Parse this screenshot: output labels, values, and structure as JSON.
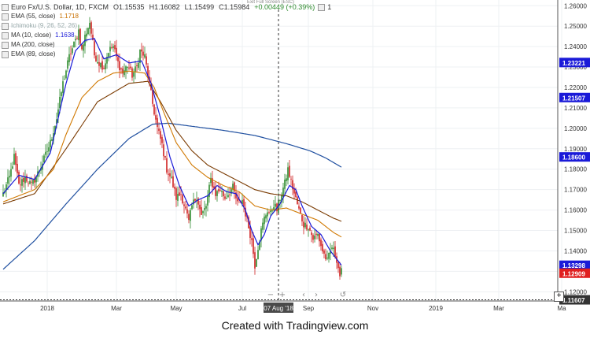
{
  "header": {
    "symbol": "Euro Fx/U.S. Dollar, 1D, FXCM",
    "open": "O1.15535",
    "high": "H1.16082",
    "low": "L1.15499",
    "close": "C1.15984",
    "change": "+0.00449 (+0.39%)",
    "badge": "1",
    "exit_full_screen": "Exit Full Screen (ESC)"
  },
  "indicators": [
    {
      "label": "EMA (55, close)",
      "value": "1.1718",
      "color": "#c87000"
    },
    {
      "label": "Ichimoku (9, 26, 52, 26)",
      "value": "",
      "color": "#999999"
    },
    {
      "label": "MA (10, close)",
      "value": "1.1638",
      "color": "#1a1ad8"
    },
    {
      "label": "MA (200, close)",
      "value": "",
      "color": "#2050a0"
    },
    {
      "label": "EMA (89, close)",
      "value": "",
      "color": "#7a3a00"
    }
  ],
  "footer": {
    "text": "Created with Tradingview.com"
  },
  "crosshair_date": "07 Aug '18",
  "chart_data": {
    "type": "candlestick",
    "x_ticks": [
      "2018",
      "Mar",
      "May",
      "Jul",
      "Sep",
      "Nov",
      "2019",
      "Mar",
      "Ma"
    ],
    "y_ticks": [
      "1.26000",
      "1.25000",
      "1.24000",
      "1.23000",
      "1.22000",
      "1.21000",
      "1.20000",
      "1.19000",
      "1.18000",
      "1.17000",
      "1.16000",
      "1.15000",
      "1.14000",
      "1.13000",
      "1.12000"
    ],
    "ylim": [
      1.1155,
      1.2628
    ],
    "price_labels": [
      {
        "text": "1.23221",
        "value": 1.23221,
        "color": "#1a1ad8"
      },
      {
        "text": "1.21507",
        "value": 1.21507,
        "color": "#1a1ad8"
      },
      {
        "text": "1.18600",
        "value": 1.186,
        "color": "#1a1ad8"
      },
      {
        "text": "1.13298",
        "value": 1.13298,
        "color": "#1a1ad8"
      },
      {
        "text": "1.12909",
        "value": 1.12909,
        "color": "#e02020"
      },
      {
        "text": "1.11607",
        "value": 1.11607,
        "color": "#333333"
      }
    ],
    "horizontal_line": 1.11607,
    "up_color": "#2e8b2e",
    "down_color": "#d02020",
    "keypoints": [
      [
        0,
        1.168
      ],
      [
        4,
        1.176
      ],
      [
        7,
        1.186
      ],
      [
        10,
        1.172
      ],
      [
        14,
        1.176
      ],
      [
        18,
        1.172
      ],
      [
        22,
        1.178
      ],
      [
        26,
        1.185
      ],
      [
        30,
        1.193
      ],
      [
        34,
        1.205
      ],
      [
        38,
        1.222
      ],
      [
        42,
        1.235
      ],
      [
        46,
        1.243
      ],
      [
        48,
        1.248
      ],
      [
        50,
        1.238
      ],
      [
        52,
        1.245
      ],
      [
        55,
        1.252
      ],
      [
        58,
        1.236
      ],
      [
        61,
        1.232
      ],
      [
        64,
        1.23
      ],
      [
        67,
        1.238
      ],
      [
        70,
        1.24
      ],
      [
        73,
        1.232
      ],
      [
        76,
        1.227
      ],
      [
        79,
        1.231
      ],
      [
        82,
        1.226
      ],
      [
        85,
        1.23
      ],
      [
        87,
        1.238
      ],
      [
        90,
        1.235
      ],
      [
        92,
        1.226
      ],
      [
        95,
        1.212
      ],
      [
        98,
        1.2
      ],
      [
        101,
        1.192
      ],
      [
        104,
        1.18
      ],
      [
        107,
        1.175
      ],
      [
        110,
        1.166
      ],
      [
        113,
        1.168
      ],
      [
        116,
        1.16
      ],
      [
        118,
        1.154
      ],
      [
        120,
        1.162
      ],
      [
        123,
        1.167
      ],
      [
        126,
        1.157
      ],
      [
        129,
        1.162
      ],
      [
        132,
        1.175
      ],
      [
        135,
        1.168
      ],
      [
        138,
        1.17
      ],
      [
        141,
        1.166
      ],
      [
        143,
        1.168
      ],
      [
        146,
        1.171
      ],
      [
        149,
        1.163
      ],
      [
        152,
        1.165
      ],
      [
        155,
        1.155
      ],
      [
        158,
        1.145
      ],
      [
        160,
        1.133
      ],
      [
        162,
        1.142
      ],
      [
        164,
        1.15
      ],
      [
        166,
        1.156
      ],
      [
        168,
        1.16
      ],
      [
        170,
        1.158
      ],
      [
        172,
        1.163
      ],
      [
        174,
        1.16
      ],
      [
        176,
        1.166
      ],
      [
        179,
        1.173
      ],
      [
        181,
        1.18
      ],
      [
        183,
        1.174
      ],
      [
        185,
        1.168
      ],
      [
        188,
        1.16
      ],
      [
        191,
        1.153
      ],
      [
        194,
        1.152
      ],
      [
        197,
        1.146
      ],
      [
        200,
        1.148
      ],
      [
        203,
        1.14
      ],
      [
        206,
        1.135
      ],
      [
        209,
        1.142
      ],
      [
        212,
        1.136
      ],
      [
        214,
        1.128
      ],
      [
        215,
        1.1298
      ]
    ],
    "ma10": [
      [
        0,
        1.168
      ],
      [
        10,
        1.177
      ],
      [
        20,
        1.175
      ],
      [
        30,
        1.188
      ],
      [
        40,
        1.222
      ],
      [
        46,
        1.238
      ],
      [
        52,
        1.243
      ],
      [
        58,
        1.244
      ],
      [
        64,
        1.234
      ],
      [
        72,
        1.236
      ],
      [
        80,
        1.232
      ],
      [
        88,
        1.233
      ],
      [
        94,
        1.222
      ],
      [
        100,
        1.205
      ],
      [
        106,
        1.186
      ],
      [
        112,
        1.172
      ],
      [
        118,
        1.162
      ],
      [
        124,
        1.165
      ],
      [
        130,
        1.167
      ],
      [
        136,
        1.172
      ],
      [
        142,
        1.169
      ],
      [
        148,
        1.168
      ],
      [
        154,
        1.16
      ],
      [
        158,
        1.15
      ],
      [
        162,
        1.143
      ],
      [
        166,
        1.148
      ],
      [
        170,
        1.157
      ],
      [
        176,
        1.163
      ],
      [
        182,
        1.172
      ],
      [
        186,
        1.17
      ],
      [
        190,
        1.162
      ],
      [
        196,
        1.152
      ],
      [
        202,
        1.148
      ],
      [
        208,
        1.14
      ],
      [
        213,
        1.135
      ],
      [
        215,
        1.133
      ]
    ],
    "ema55": [
      [
        0,
        1.164
      ],
      [
        20,
        1.17
      ],
      [
        32,
        1.18
      ],
      [
        40,
        1.197
      ],
      [
        50,
        1.215
      ],
      [
        60,
        1.223
      ],
      [
        70,
        1.227
      ],
      [
        80,
        1.228
      ],
      [
        90,
        1.227
      ],
      [
        96,
        1.22
      ],
      [
        102,
        1.208
      ],
      [
        110,
        1.193
      ],
      [
        120,
        1.182
      ],
      [
        130,
        1.176
      ],
      [
        140,
        1.172
      ],
      [
        150,
        1.169
      ],
      [
        160,
        1.162
      ],
      [
        170,
        1.16
      ],
      [
        180,
        1.161
      ],
      [
        190,
        1.158
      ],
      [
        200,
        1.155
      ],
      [
        210,
        1.149
      ],
      [
        215,
        1.1468
      ]
    ],
    "ema89": [
      [
        0,
        1.163
      ],
      [
        20,
        1.168
      ],
      [
        40,
        1.19
      ],
      [
        60,
        1.213
      ],
      [
        80,
        1.222
      ],
      [
        92,
        1.223
      ],
      [
        100,
        1.213
      ],
      [
        110,
        1.199
      ],
      [
        120,
        1.189
      ],
      [
        130,
        1.182
      ],
      [
        140,
        1.178
      ],
      [
        150,
        1.174
      ],
      [
        160,
        1.17
      ],
      [
        170,
        1.168
      ],
      [
        180,
        1.167
      ],
      [
        190,
        1.164
      ],
      [
        200,
        1.16
      ],
      [
        210,
        1.156
      ],
      [
        215,
        1.1545
      ]
    ],
    "ma200": [
      [
        0,
        1.131
      ],
      [
        20,
        1.145
      ],
      [
        40,
        1.163
      ],
      [
        60,
        1.18
      ],
      [
        80,
        1.195
      ],
      [
        95,
        1.202
      ],
      [
        105,
        1.2025
      ],
      [
        120,
        1.201
      ],
      [
        140,
        1.199
      ],
      [
        160,
        1.1965
      ],
      [
        180,
        1.1925
      ],
      [
        195,
        1.189
      ],
      [
        205,
        1.1855
      ],
      [
        215,
        1.181
      ]
    ]
  }
}
